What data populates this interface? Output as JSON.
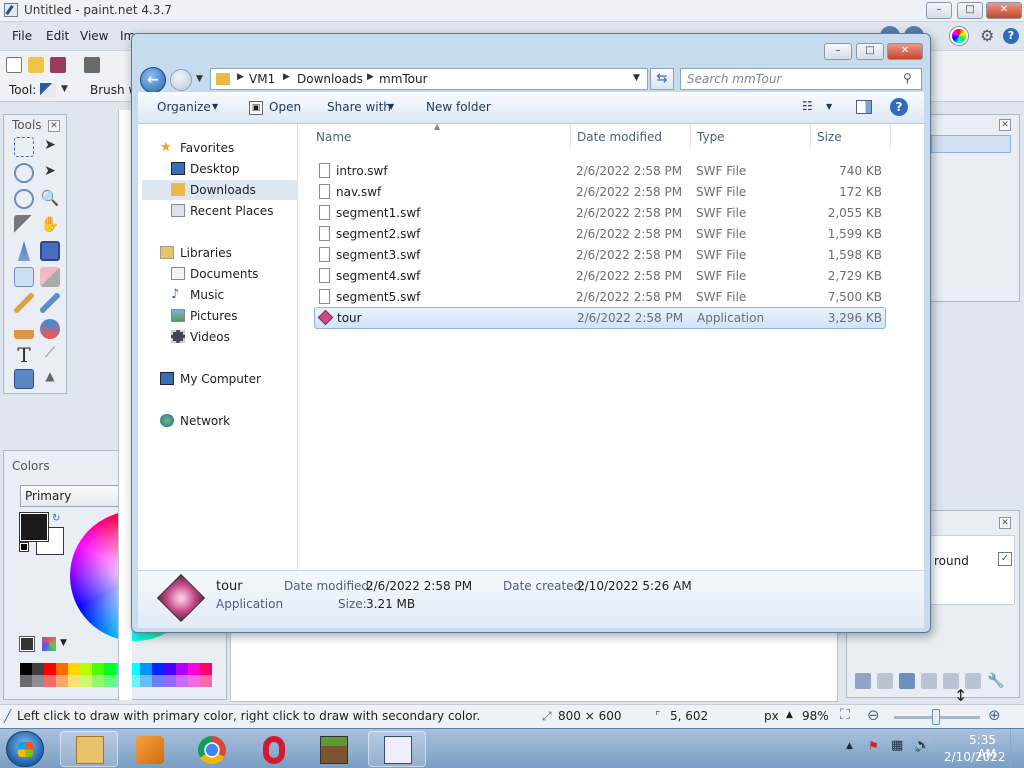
{
  "paintnet": {
    "title": "Untitled - paint.net 4.3.7",
    "menu": [
      "File",
      "Edit",
      "View",
      "Im"
    ],
    "tool_label": "Tool:",
    "brush_label": "Brush w",
    "tools_panel_title": "Tools",
    "colors_panel_title": "Colors",
    "primary_select": "Primary",
    "layers_panel_text": "round",
    "status_hint": "Left click to draw with primary color, right click to draw with secondary color.",
    "image_size": "800 × 600",
    "cursor_pos": "5, 602",
    "unit": "px",
    "zoom": "98%",
    "palette": [
      "#000000",
      "#404040",
      "#ff0000",
      "#ff6a00",
      "#ffd800",
      "#b6ff00",
      "#4cff00",
      "#00ff21",
      "#00ff90",
      "#00ffff",
      "#0094ff",
      "#0026ff",
      "#4800ff",
      "#b200ff",
      "#ff00dc",
      "#ff006e"
    ]
  },
  "explorer": {
    "breadcrumb": [
      "VM1",
      "Downloads",
      "mmTour"
    ],
    "search_placeholder": "Search mmTour",
    "toolbar": {
      "organize": "Organize",
      "open": "Open",
      "share_with": "Share with",
      "new_folder": "New folder"
    },
    "nav": {
      "favorites": "Favorites",
      "favorites_items": [
        "Desktop",
        "Downloads",
        "Recent Places"
      ],
      "libraries": "Libraries",
      "library_items": [
        "Documents",
        "Music",
        "Pictures",
        "Videos"
      ],
      "computer": "My Computer",
      "network": "Network"
    },
    "columns": [
      "Name",
      "Date modified",
      "Type",
      "Size"
    ],
    "files": [
      {
        "name": "intro.swf",
        "date": "2/6/2022 2:58 PM",
        "type": "SWF File",
        "size": "740 KB"
      },
      {
        "name": "nav.swf",
        "date": "2/6/2022 2:58 PM",
        "type": "SWF File",
        "size": "172 KB"
      },
      {
        "name": "segment1.swf",
        "date": "2/6/2022 2:58 PM",
        "type": "SWF File",
        "size": "2,055 KB"
      },
      {
        "name": "segment2.swf",
        "date": "2/6/2022 2:58 PM",
        "type": "SWF File",
        "size": "1,599 KB"
      },
      {
        "name": "segment3.swf",
        "date": "2/6/2022 2:58 PM",
        "type": "SWF File",
        "size": "1,598 KB"
      },
      {
        "name": "segment4.swf",
        "date": "2/6/2022 2:58 PM",
        "type": "SWF File",
        "size": "2,729 KB"
      },
      {
        "name": "segment5.swf",
        "date": "2/6/2022 2:58 PM",
        "type": "SWF File",
        "size": "7,500 KB"
      },
      {
        "name": "tour",
        "date": "2/6/2022 2:58 PM",
        "type": "Application",
        "size": "3,296 KB",
        "selected": true
      }
    ],
    "details": {
      "name": "tour",
      "type": "Application",
      "date_modified_label": "Date modified:",
      "date_modified": "2/6/2022 2:58 PM",
      "date_created_label": "Date created:",
      "date_created": "2/10/2022 5:26 AM",
      "size_label": "Size:",
      "size": "3.21 MB"
    }
  },
  "taskbar": {
    "time": "5:35 AM",
    "date": "2/10/2022",
    "apps": [
      "windows-explorer",
      "media-player",
      "chrome",
      "opera",
      "minecraft",
      "paint-net"
    ]
  }
}
